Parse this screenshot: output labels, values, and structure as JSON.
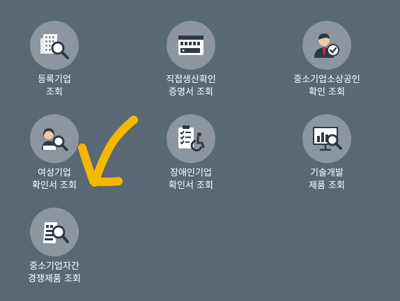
{
  "tiles": [
    {
      "icon": "building-search-icon",
      "line1": "등록기업",
      "line2": "조회"
    },
    {
      "icon": "certificate-card-icon",
      "line1": "직접생산확인",
      "line2": "증명서 조회"
    },
    {
      "icon": "businessman-check-icon",
      "line1": "중소기업소상공인",
      "line2": "확인 조회"
    },
    {
      "icon": "woman-search-icon",
      "line1": "여성기업",
      "line2": "확인서 조회"
    },
    {
      "icon": "checklist-wheelchair-icon",
      "line1": "장애인기업",
      "line2": "확인서 조회"
    },
    {
      "icon": "chart-search-icon",
      "line1": "기술개발",
      "line2": "제품 조회"
    },
    {
      "icon": "product-search-icon",
      "line1": "중소기업자간",
      "line2": "경쟁제품 조회"
    }
  ],
  "annotation": {
    "color": "#f5b800",
    "icon": "yellow-arrow-annotation"
  }
}
